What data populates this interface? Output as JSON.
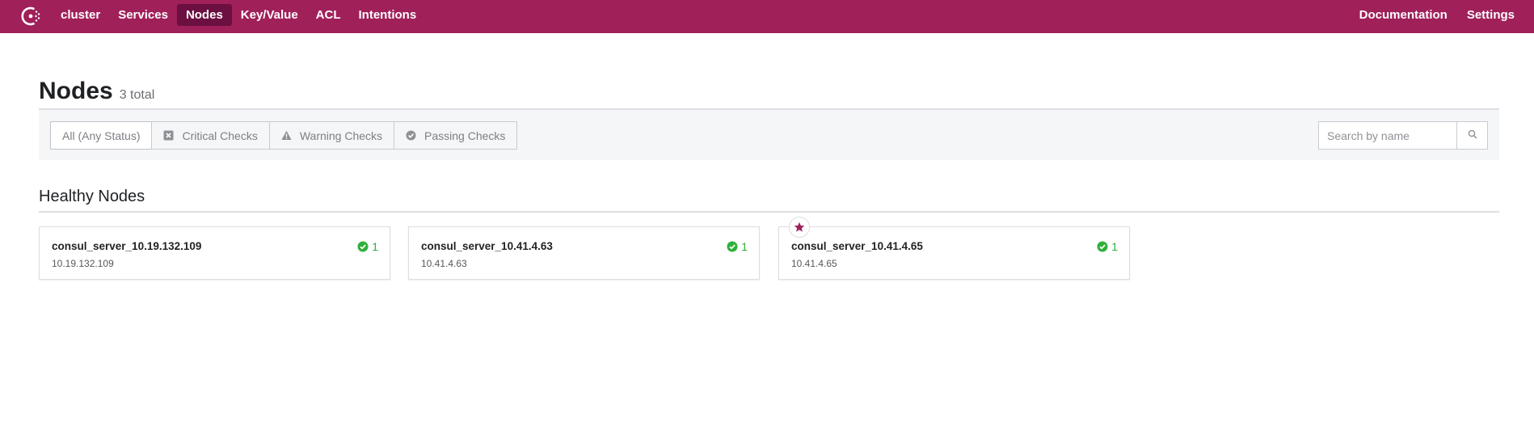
{
  "nav": {
    "left": [
      {
        "label": "cluster",
        "active": false
      },
      {
        "label": "Services",
        "active": false
      },
      {
        "label": "Nodes",
        "active": true
      },
      {
        "label": "Key/Value",
        "active": false
      },
      {
        "label": "ACL",
        "active": false
      },
      {
        "label": "Intentions",
        "active": false
      }
    ],
    "right": [
      {
        "label": "Documentation"
      },
      {
        "label": "Settings"
      }
    ],
    "logo_icon": "consul-logo-icon"
  },
  "page": {
    "title": "Nodes",
    "count": "3 total"
  },
  "filters": {
    "items": [
      {
        "label": "All (Any Status)",
        "icon": "",
        "selected": true
      },
      {
        "label": "Critical Checks",
        "icon": "critical-icon"
      },
      {
        "label": "Warning Checks",
        "icon": "warning-icon"
      },
      {
        "label": "Passing Checks",
        "icon": "passing-icon"
      }
    ],
    "search_placeholder": "Search by name"
  },
  "section": {
    "title": "Healthy Nodes"
  },
  "nodes": [
    {
      "name": "consul_server_10.19.132.109",
      "address": "10.19.132.109",
      "passing": "1",
      "leader": false
    },
    {
      "name": "consul_server_10.41.4.63",
      "address": "10.41.4.63",
      "passing": "1",
      "leader": false
    },
    {
      "name": "consul_server_10.41.4.65",
      "address": "10.41.4.65",
      "passing": "1",
      "leader": true
    }
  ],
  "colors": {
    "brand": "#a0205a",
    "active_nav": "#6b1040",
    "passing": "#2eb039"
  }
}
